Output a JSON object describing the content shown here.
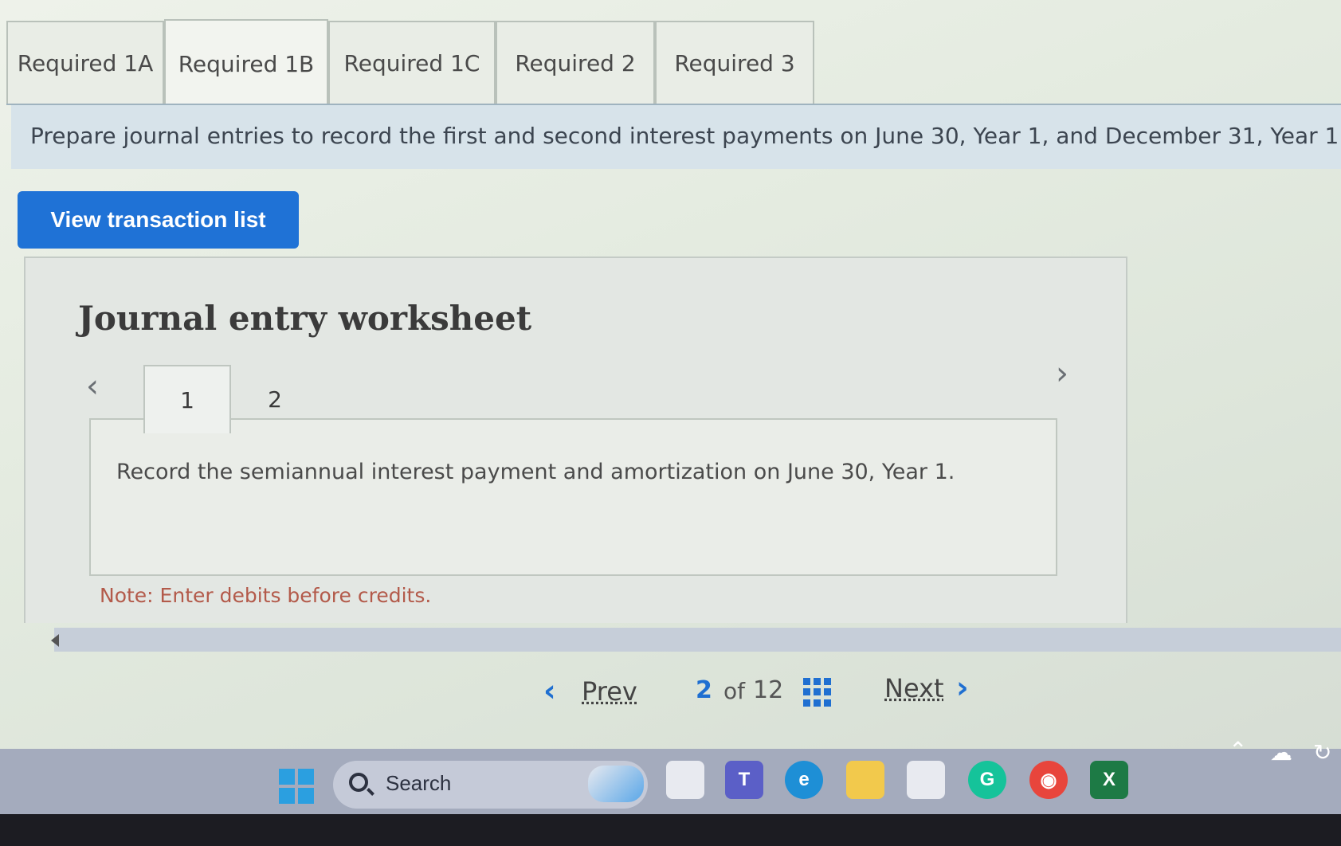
{
  "tabs": [
    {
      "label": "Required 1A",
      "active": false
    },
    {
      "label": "Required 1B",
      "active": true
    },
    {
      "label": "Required 1C",
      "active": false
    },
    {
      "label": "Required 2",
      "active": false
    },
    {
      "label": "Required 3",
      "active": false
    }
  ],
  "instruction": "Prepare journal entries to record the first and second interest payments on June 30, Year 1, and December 31, Year 1.",
  "view_transaction_button": "View transaction list",
  "worksheet": {
    "title": "Journal entry worksheet",
    "entry_tabs": [
      "1",
      "2"
    ],
    "active_entry": "1",
    "entry_description": "Record the semiannual interest payment and amortization on June 30, Year 1.",
    "note": "Note: Enter debits before credits."
  },
  "pagination": {
    "prev_label": "Prev",
    "current": "2",
    "of_label": "of",
    "total": "12",
    "next_label": "Next"
  },
  "taskbar": {
    "search_label": "Search",
    "icons": [
      "windows-start-icon",
      "task-view-icon",
      "teams-icon",
      "edge-icon",
      "file-explorer-icon",
      "store-icon",
      "grammarly-icon",
      "chrome-icon",
      "excel-icon"
    ]
  },
  "colors": {
    "primary_button": "#1f72d6",
    "link_accent": "#1f6fd1",
    "note_text": "#b35a4a",
    "banner_bg": "#d7e3ea"
  }
}
